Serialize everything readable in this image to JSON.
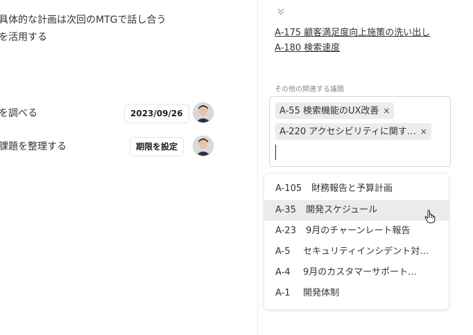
{
  "left": {
    "lines": [
      "具体的な計画は次回のMTGで話し合う",
      "を活用する"
    ],
    "tasks": [
      {
        "text": "を調べる",
        "badge": "2023/09/26"
      },
      {
        "text": "課題を整理する",
        "badge": "期限を設定"
      }
    ]
  },
  "right": {
    "links": [
      "A-175 顧客満足度向上施策の洗い出し",
      "A-180 検索速度"
    ],
    "related_label": "その他の関連する議題",
    "chips": [
      {
        "label": "A-55 検索機能のUX改善"
      },
      {
        "label": "A-220 アクセシビリティに関す…"
      }
    ],
    "chip_remove": "×",
    "options": [
      {
        "id": "A-105",
        "name": "財務報告と予算計画"
      },
      {
        "id": "A-35",
        "name": "開発スケジュール"
      },
      {
        "id": "A-23",
        "name": "9月のチャーンレート報告"
      },
      {
        "id": "A-5",
        "name": "セキュリティインシデント対…"
      },
      {
        "id": "A-4",
        "name": "9月のカスタマーサポート…"
      },
      {
        "id": "A-1",
        "name": "開発体制"
      }
    ],
    "highlighted_option": "A-35"
  },
  "icons": {
    "collapse": "chevron-double-down-icon",
    "cursor": "hand-pointer-icon"
  },
  "colors": {
    "highlight": "#ebebeb",
    "chip_bg": "#ececec",
    "divider": "#e8e8e8"
  }
}
